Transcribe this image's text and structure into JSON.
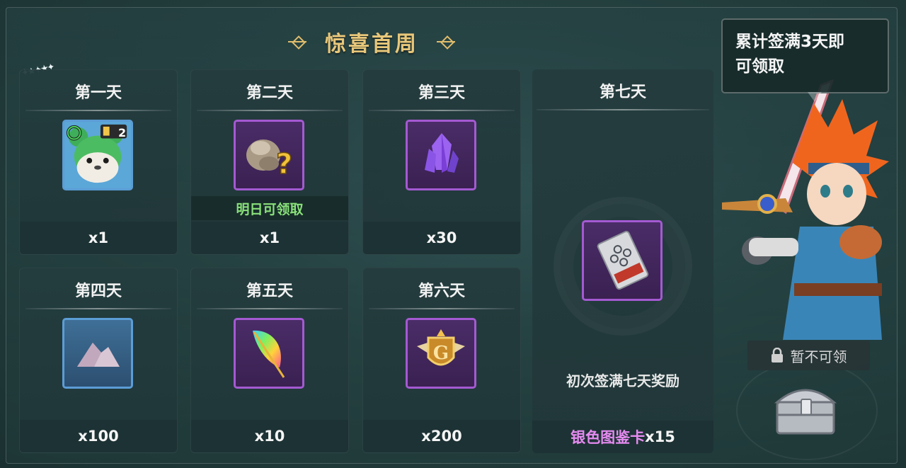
{
  "title": "惊喜首周",
  "cards": [
    {
      "day": "第一天",
      "qty": "x1",
      "frame": "blue",
      "item": "green-dragon-pet",
      "badge": "2"
    },
    {
      "day": "第二天",
      "qty": "x1",
      "frame": "purple",
      "item": "mystery-ore",
      "status": "明日可领取"
    },
    {
      "day": "第三天",
      "qty": "x30",
      "frame": "purple",
      "item": "purple-crystal"
    },
    {
      "day": "第四天",
      "qty": "x100",
      "frame": "blue",
      "item": "dust-pile"
    },
    {
      "day": "第五天",
      "qty": "x10",
      "frame": "purple",
      "item": "rainbow-feather"
    },
    {
      "day": "第六天",
      "qty": "x200",
      "frame": "purple",
      "item": "gold-g-emblem"
    }
  ],
  "day7": {
    "day": "第七天",
    "desc": "初次签满七天奖励",
    "reward_name": "银色图鉴卡",
    "reward_qty": "x15",
    "item": "silver-card"
  },
  "bubble": {
    "line1": "累计签满3天即",
    "line2": "可领取"
  },
  "claim": {
    "label": "暂不可领",
    "icon": "lock-icon"
  },
  "colors": {
    "title": "#e8c77a",
    "status_green": "#89e07a",
    "reward_pink": "#e58bf0"
  }
}
